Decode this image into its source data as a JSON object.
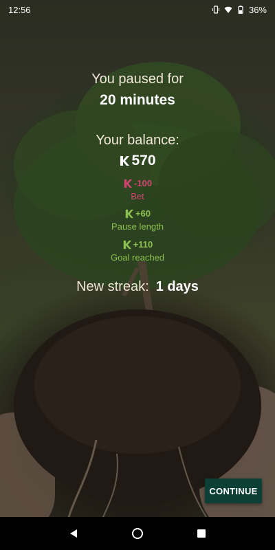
{
  "status_bar": {
    "time": "12:56",
    "battery": "36%",
    "icons": [
      "vibrate-icon",
      "wifi-icon",
      "battery-icon"
    ]
  },
  "summary": {
    "paused_label": "You paused for",
    "paused_value": "20 minutes",
    "balance_label": "Your balance:",
    "balance_value": "570",
    "adjustments": [
      {
        "amount": "-100",
        "label": "Bet",
        "kind": "negative",
        "color": "#d0446f"
      },
      {
        "amount": "+60",
        "label": "Pause length",
        "kind": "positive",
        "color": "#8cc152"
      },
      {
        "amount": "+110",
        "label": "Goal reached",
        "kind": "positive",
        "color": "#8cc152"
      }
    ],
    "streak_label": "New streak:",
    "streak_value": "1 days"
  },
  "actions": {
    "continue_label": "CONTINUE",
    "continue_color": "#0c3f36"
  },
  "nav": {
    "buttons": [
      "back-icon",
      "home-icon",
      "recents-icon"
    ]
  }
}
